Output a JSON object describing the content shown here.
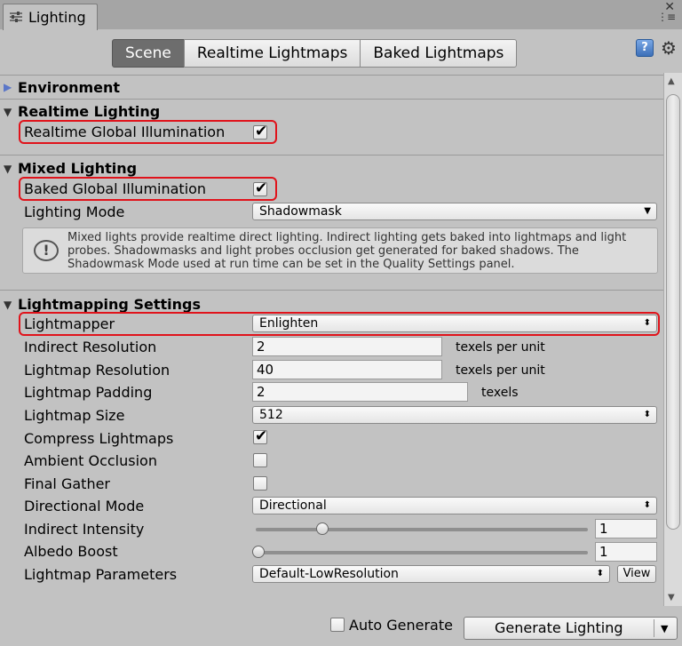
{
  "window": {
    "tab_title": "Lighting",
    "close_glyph": "✕",
    "menu_glyph": "⋮≡"
  },
  "mode_tabs": [
    {
      "label": "Scene",
      "active": true
    },
    {
      "label": "Realtime Lightmaps",
      "active": false
    },
    {
      "label": "Baked Lightmaps",
      "active": false
    }
  ],
  "toolbar": {
    "help_glyph": "?",
    "gear_glyph": "⚙"
  },
  "environment": {
    "header": "Environment",
    "expanded": false
  },
  "realtime_lighting": {
    "header": "Realtime Lighting",
    "expanded": true,
    "rtgi_label": "Realtime Global Illumination",
    "rtgi_checked": true
  },
  "mixed_lighting": {
    "header": "Mixed Lighting",
    "expanded": true,
    "bakedgi_label": "Baked Global Illumination",
    "bakedgi_checked": true,
    "mode_label": "Lighting Mode",
    "mode_value": "Shadowmask",
    "help_text": "Mixed lights provide realtime direct lighting. Indirect lighting gets baked into lightmaps and light probes. Shadowmasks and light probes occlusion get generated for baked shadows. The Shadowmask Mode used at run time can be set in the Quality Settings panel."
  },
  "lightmapping": {
    "header": "Lightmapping Settings",
    "expanded": true,
    "lightmapper": {
      "label": "Lightmapper",
      "value": "Enlighten"
    },
    "indirect_resolution": {
      "label": "Indirect Resolution",
      "value": "2",
      "unit": "texels per unit"
    },
    "lightmap_resolution": {
      "label": "Lightmap Resolution",
      "value": "40",
      "unit": "texels per unit"
    },
    "lightmap_padding": {
      "label": "Lightmap Padding",
      "value": "2",
      "unit": "texels"
    },
    "lightmap_size": {
      "label": "Lightmap Size",
      "value": "512"
    },
    "compress_lightmaps": {
      "label": "Compress Lightmaps",
      "checked": true
    },
    "ambient_occlusion": {
      "label": "Ambient Occlusion",
      "checked": false
    },
    "final_gather": {
      "label": "Final Gather",
      "checked": false
    },
    "directional_mode": {
      "label": "Directional Mode",
      "value": "Directional"
    },
    "indirect_intensity": {
      "label": "Indirect Intensity",
      "value": "1",
      "slider_fraction": 0.2
    },
    "albedo_boost": {
      "label": "Albedo Boost",
      "value": "1",
      "slider_fraction": 0.0
    },
    "lightmap_parameters": {
      "label": "Lightmap Parameters",
      "value": "Default-LowResolution",
      "view_label": "View"
    }
  },
  "footer": {
    "auto_generate_label": "Auto Generate",
    "auto_generate_checked": false,
    "generate_label": "Generate Lighting"
  },
  "glyphs": {
    "check": "✔",
    "foldout_open": "▼",
    "foldout_closed": "▶",
    "dropdown_arrow": "▼",
    "dropdown_updown": "⬍"
  },
  "colors": {
    "highlight": "#e0131b",
    "panel_bg": "#c2c2c2",
    "active_tab": "#6d6d6d"
  }
}
